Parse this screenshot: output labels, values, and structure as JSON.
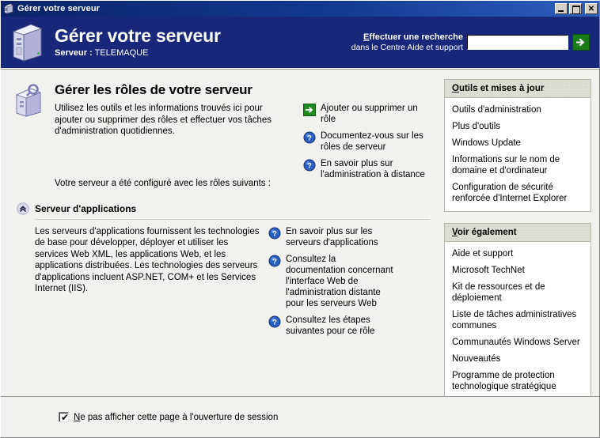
{
  "window": {
    "title": "Gérer votre serveur",
    "title_icon": "server-icon",
    "minimize_label": "Réduire",
    "maximize_label": "Agrandir",
    "close_label": "Fermer",
    "close_glyph": "✕"
  },
  "banner": {
    "icon": "server-tower-icon",
    "title": "Gérer votre serveur",
    "server_prefix": "Serveur :",
    "server_name": "TELEMAQUE",
    "search": {
      "label_line1_accel": "E",
      "label_line1_rest": "ffectuer une recherche",
      "label_line2": "dans le Centre Aide et support",
      "value": "",
      "placeholder": "",
      "go_icon": "green-arrow-icon",
      "go_label": "Rechercher"
    }
  },
  "main": {
    "icon": "server-config-icon",
    "heading": "Gérer les rôles de votre serveur",
    "intro_text": "Utilisez les outils et les informations trouvés ici pour ajouter ou supprimer des rôles et effectuer vos tâches d'administration quotidiennes.",
    "configured_note": "Votre serveur a été configuré avec les rôles suivants :",
    "intro_links": [
      {
        "icon": "green-arrow-icon",
        "label": "Ajouter ou supprimer un rôle"
      },
      {
        "icon": "help-question-icon",
        "label": "Documentez-vous sur les rôles de serveur"
      },
      {
        "icon": "help-question-icon",
        "label": "En savoir plus sur l'administration à distance"
      }
    ],
    "role": {
      "collapse_icon": "chevron-up-circle-icon",
      "title": "Serveur d'applications",
      "description": "Les serveurs d'applications fournissent les technologies de base pour développer, déployer et utiliser les services Web XML, les applications Web, et les applications distribuées. Les technologies des serveurs d'applications incluent ASP.NET, COM+ et les Services Internet (IIS).",
      "links": [
        {
          "icon": "help-question-icon",
          "label": "En savoir plus sur les serveurs d'applications"
        },
        {
          "icon": "help-question-icon",
          "label": "Consultez la documentation concernant l'interface Web de l'administration distante pour les serveurs Web"
        },
        {
          "icon": "help-question-icon",
          "label": "Consultez les étapes suivantes pour ce rôle"
        }
      ]
    }
  },
  "sidebar": {
    "panels": [
      {
        "title_accel": "O",
        "title_rest": "utils et mises à jour",
        "links": [
          "Outils d'administration",
          "Plus d'outils",
          "Windows Update",
          "Informations sur le nom de domaine et d'ordinateur",
          "Configuration de sécurité renforcée d'Internet Explorer"
        ]
      },
      {
        "title_accel": "V",
        "title_rest": "oir également",
        "links": [
          "Aide et support",
          "Microsoft TechNet",
          "Kit de ressources et de déploiement",
          "Liste de tâches administratives communes",
          "Communautés Windows Server",
          "Nouveautés",
          "Programme de protection technologique stratégique"
        ]
      }
    ]
  },
  "footer": {
    "checkbox_checked": true,
    "checkbox_check_glyph": "✔",
    "checkbox_accel": "N",
    "checkbox_rest": "e pas afficher cette page à l'ouverture de session"
  },
  "colors": {
    "banner_blue": "#17287a",
    "titlebar_blue": "#0a246a",
    "body_bg": "#f1f1ee",
    "panel_head": "#d9d9d0",
    "go_green": "#1a7a1a",
    "help_blue": "#2a5fc4"
  }
}
